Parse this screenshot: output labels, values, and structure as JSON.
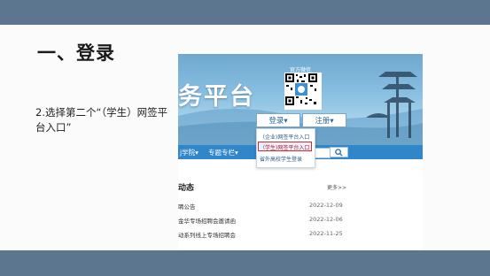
{
  "slide": {
    "heading": "一、登录",
    "instruction": "2.选择第二个“（学生）网签平台入口”"
  },
  "screenshot": {
    "banner_title": "务平台",
    "qr_caption": "官方微信",
    "login_button": "登录▾",
    "register_button": "注册▾",
    "dropdown": [
      "（企业)网签平台入口",
      "（学生)网签平台入口",
      "省外高校学生登录"
    ],
    "highlight_color": "#d6283a",
    "nav": [
      "j学院▾",
      "专题专栏▾"
    ],
    "news": {
      "title": "动态",
      "more": "更多>>",
      "rows": [
        {
          "title": "聘公告",
          "date": "2022-12-09"
        },
        {
          "title": "金华专场招聘会邀请函",
          "date": "2022-12-06"
        },
        {
          "title": "动系列线上专场招聘会",
          "date": "2022-11-25"
        }
      ]
    }
  },
  "colors": {
    "band": "#5d7690",
    "nav_blue": "#2f86c9"
  }
}
